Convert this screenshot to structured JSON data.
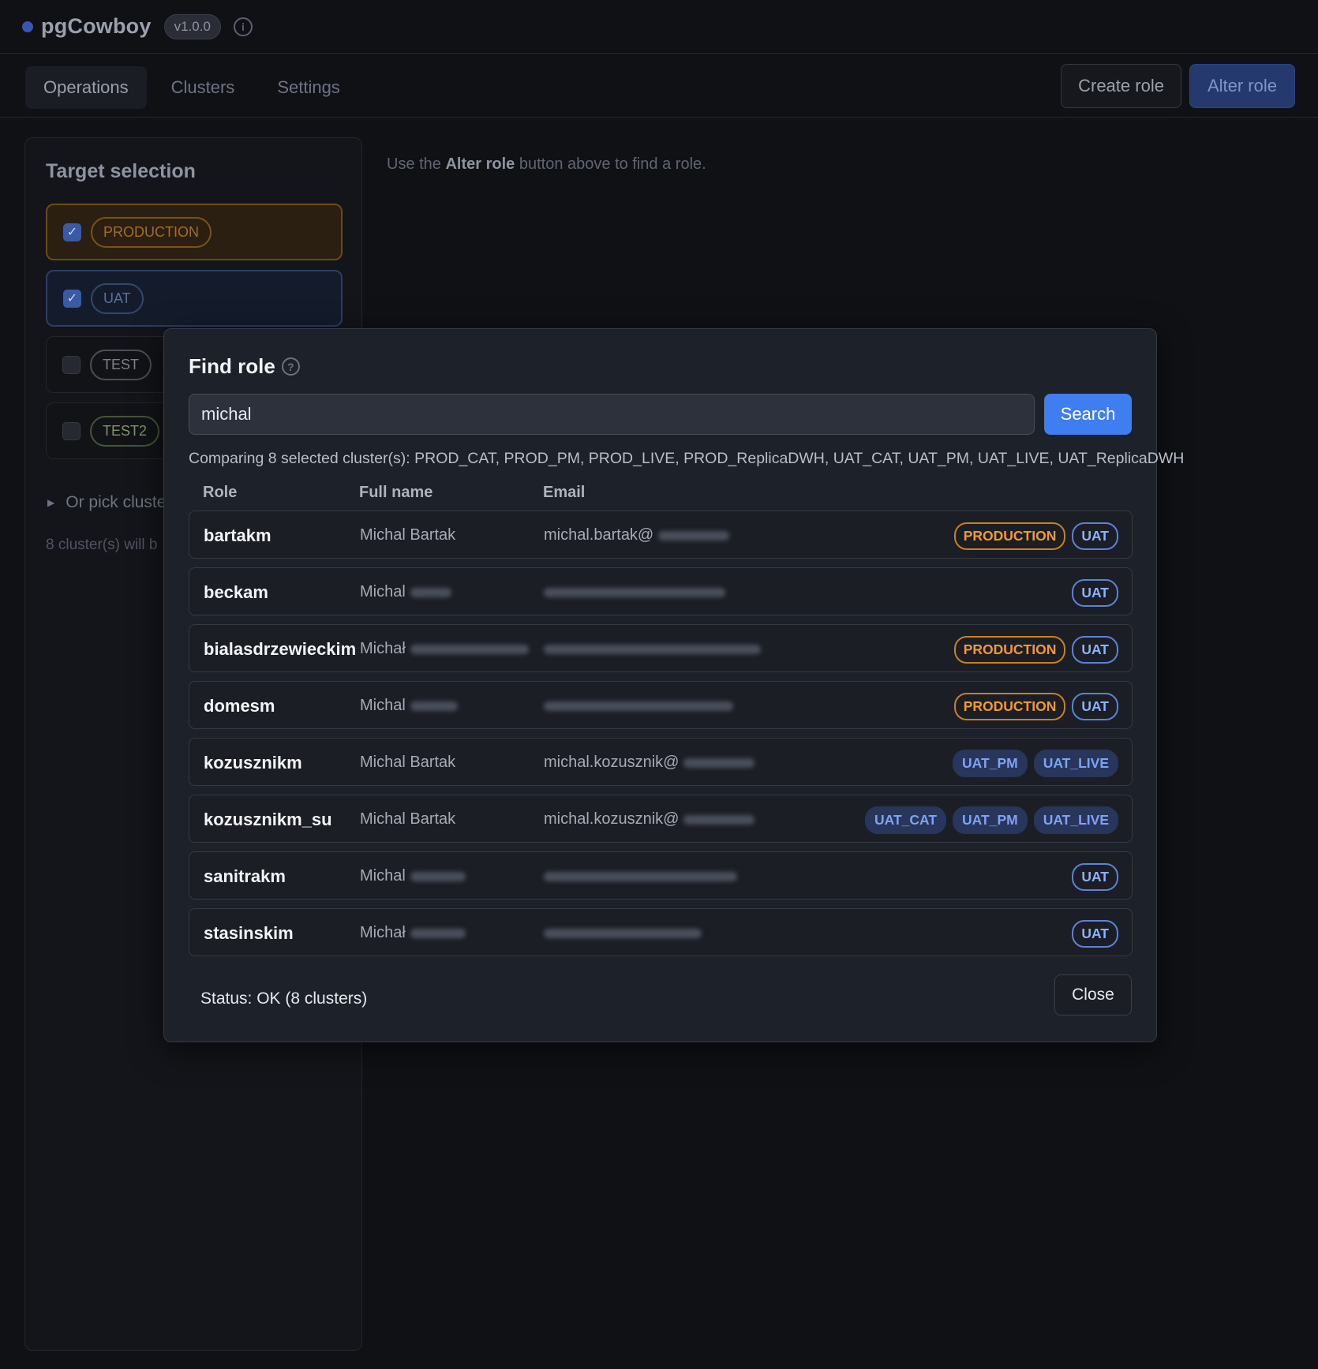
{
  "app": {
    "name": "pgCowboy",
    "version": "v1.0.0",
    "info_icon": "info-icon"
  },
  "nav": {
    "tabs": [
      {
        "label": "Operations",
        "active": true
      },
      {
        "label": "Clusters",
        "active": false
      },
      {
        "label": "Settings",
        "active": false
      }
    ],
    "create_role_label": "Create role",
    "alter_role_label": "Alter role"
  },
  "target_selection": {
    "title": "Target selection",
    "environments": [
      {
        "label": "PRODUCTION",
        "checked": true
      },
      {
        "label": "UAT",
        "checked": true
      },
      {
        "label": "TEST",
        "checked": false
      },
      {
        "label": "TEST2",
        "checked": false
      }
    ],
    "pick_clusters_label": "Or pick cluste",
    "cluster_count_note": "8 cluster(s) will b"
  },
  "main_hint": {
    "prefix": "Use the ",
    "bold": "Alter role",
    "suffix": " button above to find a role."
  },
  "modal": {
    "title": "Find role",
    "search_value": "michal",
    "search_button": "Search",
    "comparing_text": "Comparing 8 selected cluster(s): PROD_CAT, PROD_PM, PROD_LIVE, PROD_ReplicaDWH, UAT_CAT, UAT_PM, UAT_LIVE, UAT_ReplicaDWH",
    "columns": {
      "role": "Role",
      "full_name": "Full name",
      "email": "Email"
    },
    "rows": [
      {
        "role": "bartakm",
        "full_name": "Michal Bartak",
        "email": "michal.bartak@",
        "tags": [
          "PRODUCTION",
          "UAT"
        ]
      },
      {
        "role": "beckam",
        "full_name": "Michal",
        "email": "",
        "tags": [
          "UAT"
        ]
      },
      {
        "role": "bialasdrzewieckim",
        "full_name": "Michał",
        "email": "",
        "tags": [
          "PRODUCTION",
          "UAT"
        ]
      },
      {
        "role": "domesm",
        "full_name": "Michal",
        "email": "",
        "tags": [
          "PRODUCTION",
          "UAT"
        ]
      },
      {
        "role": "kozusznikm",
        "full_name": "Michal Bartak",
        "email": "michal.kozusznik@",
        "tags": [
          "UAT_PM",
          "UAT_LIVE"
        ]
      },
      {
        "role": "kozusznikm_su",
        "full_name": "Michal Bartak",
        "email": "michal.kozusznik@",
        "tags": [
          "UAT_CAT",
          "UAT_PM",
          "UAT_LIVE"
        ]
      },
      {
        "role": "sanitrakm",
        "full_name": "Michal",
        "email": "",
        "tags": [
          "UAT"
        ]
      },
      {
        "role": "stasinskim",
        "full_name": "Michał",
        "email": "",
        "tags": [
          "UAT"
        ]
      }
    ],
    "status": "Status: OK (8 clusters)",
    "close_label": "Close"
  },
  "colors": {
    "background": "#0f1115",
    "accent_blue": "#3f7ef0",
    "production_orange": "#f29a2e",
    "uat_blue": "#8eb1ff"
  }
}
